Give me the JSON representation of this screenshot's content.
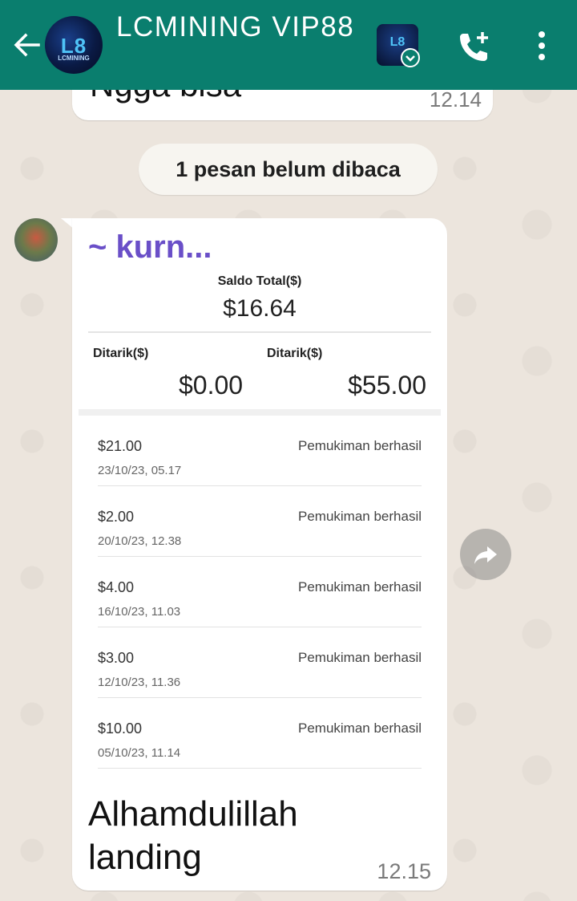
{
  "header": {
    "title": "LCMINING VIP88",
    "avatar_logo": "L8",
    "avatar_logo_sub": "LCMINING"
  },
  "previous_message": {
    "text": "Ngga bisa",
    "time": "12.14"
  },
  "unread_banner": "1 pesan belum dibaca",
  "message": {
    "sender": "~ kurn...",
    "screenshot": {
      "saldo_label": "Saldo Total($)",
      "saldo_value": "$16.64",
      "ditarik_label_1": "Ditarik($)",
      "ditarik_label_2": "Ditarik($)",
      "ditarik_value_1": "$0.00",
      "ditarik_value_2": "$55.00",
      "transactions": [
        {
          "amount": "$21.00",
          "date": "23/10/23, 05.17",
          "status": "Pemukiman berhasil"
        },
        {
          "amount": "$2.00",
          "date": "20/10/23, 12.38",
          "status": "Pemukiman berhasil"
        },
        {
          "amount": "$4.00",
          "date": "16/10/23, 11.03",
          "status": "Pemukiman berhasil"
        },
        {
          "amount": "$3.00",
          "date": "12/10/23, 11.36",
          "status": "Pemukiman berhasil"
        },
        {
          "amount": "$10.00",
          "date": "05/10/23, 11.14",
          "status": "Pemukiman berhasil"
        }
      ]
    },
    "caption_line1": "Alhamdulillah",
    "caption_line2": "landing",
    "time": "12.15"
  },
  "icons": {
    "back": "arrow-left-icon",
    "call": "add-call-icon",
    "menu": "more-vert-icon",
    "forward": "forward-icon"
  },
  "colors": {
    "appbar": "#0a7e6e",
    "sender_name": "#6a4fc8",
    "chat_background": "#ece5dd"
  }
}
